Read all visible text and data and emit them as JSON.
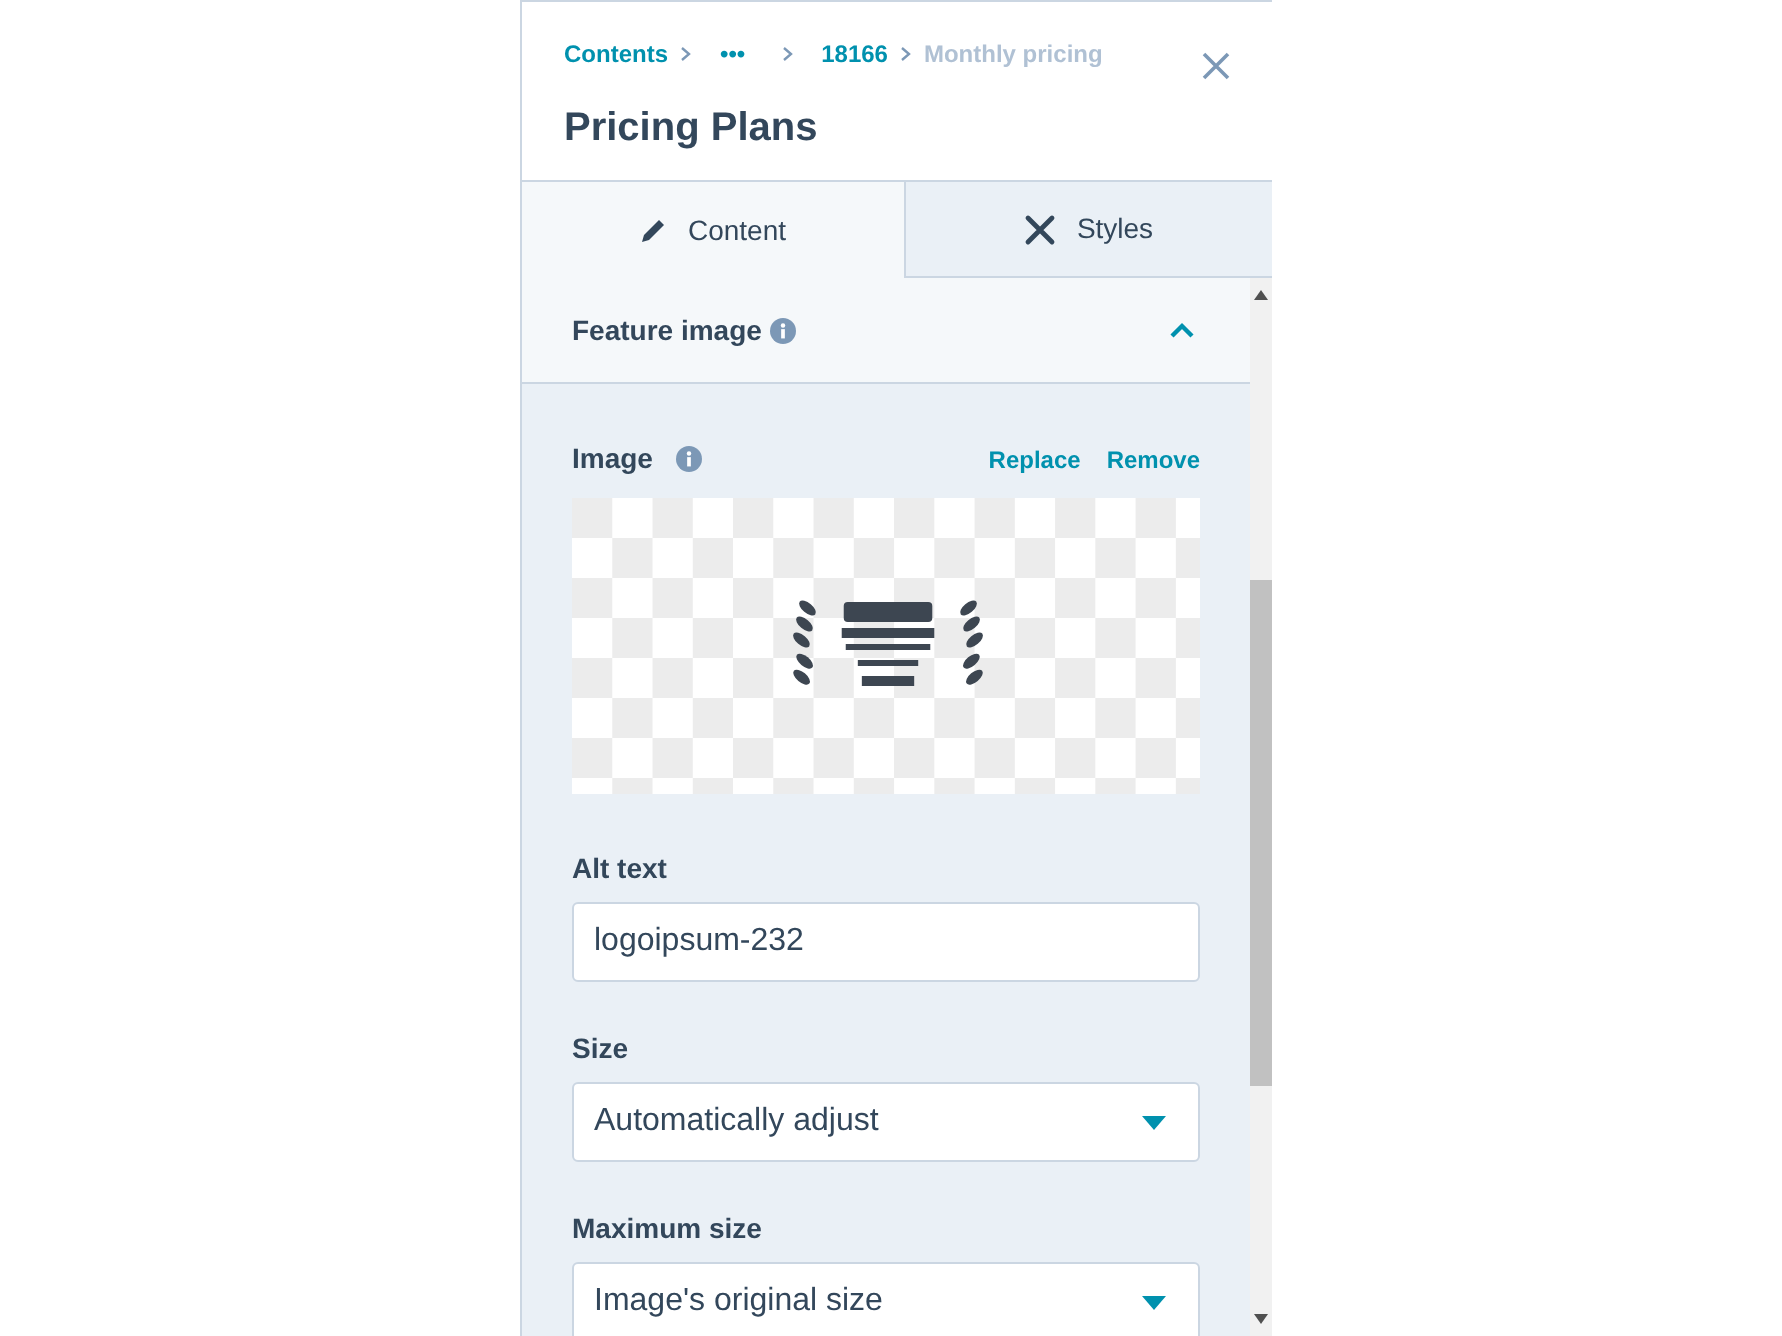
{
  "breadcrumbs": [
    {
      "label": "Contents",
      "kind": "link"
    },
    {
      "label": "•••",
      "kind": "link"
    },
    {
      "label": "18166",
      "kind": "link"
    },
    {
      "label": "Monthly pricing",
      "kind": "current"
    }
  ],
  "title": "Pricing Plans",
  "tabs": [
    {
      "label": "Content",
      "kind": "pencil",
      "selected": true
    },
    {
      "label": "Styles",
      "kind": "brush",
      "selected": false
    }
  ],
  "section": {
    "title": "Feature image",
    "expanded": true
  },
  "image_field": {
    "label": "Image",
    "actions": [
      "Replace",
      "Remove"
    ],
    "preview": {
      "kind": "picture"
    }
  },
  "fields": [
    {
      "label": "Alt text",
      "kind": "text",
      "value": "logoipsum-232"
    },
    {
      "label": "Size",
      "kind": "select",
      "value": "Automatically adjust"
    },
    {
      "label": "Maximum size",
      "kind": "select",
      "value": "Image's original size"
    }
  ]
}
